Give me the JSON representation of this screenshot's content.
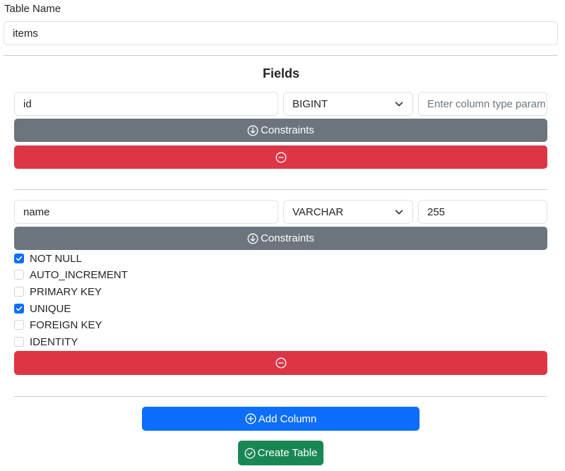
{
  "table_name": {
    "label": "Table Name",
    "value": "items"
  },
  "fields_heading": "Fields",
  "fields": [
    {
      "name": "id",
      "type": "BIGINT",
      "param_value": "",
      "param_placeholder": "Enter column type param",
      "constraints_label": "Constraints"
    },
    {
      "name": "name",
      "type": "VARCHAR",
      "param_value": "255",
      "param_placeholder": "Enter column type param",
      "constraints_label": "Constraints",
      "constraints": [
        {
          "label": "NOT NULL",
          "checked": true
        },
        {
          "label": "AUTO_INCREMENT",
          "checked": false
        },
        {
          "label": "PRIMARY KEY",
          "checked": false
        },
        {
          "label": "UNIQUE",
          "checked": true
        },
        {
          "label": "FOREIGN KEY",
          "checked": false
        },
        {
          "label": "IDENTITY",
          "checked": false
        }
      ]
    }
  ],
  "add_column_label": "Add Column",
  "create_table_label": "Create Table",
  "colors": {
    "primary": "#0d6efd",
    "secondary": "#6c757d",
    "danger": "#dc3545",
    "success": "#198754"
  },
  "icons": {
    "constraints": "arrow-down-circle-icon",
    "remove": "dash-circle-icon",
    "add": "plus-circle-icon",
    "create": "check-circle-icon",
    "select": "chevron-down-icon"
  }
}
